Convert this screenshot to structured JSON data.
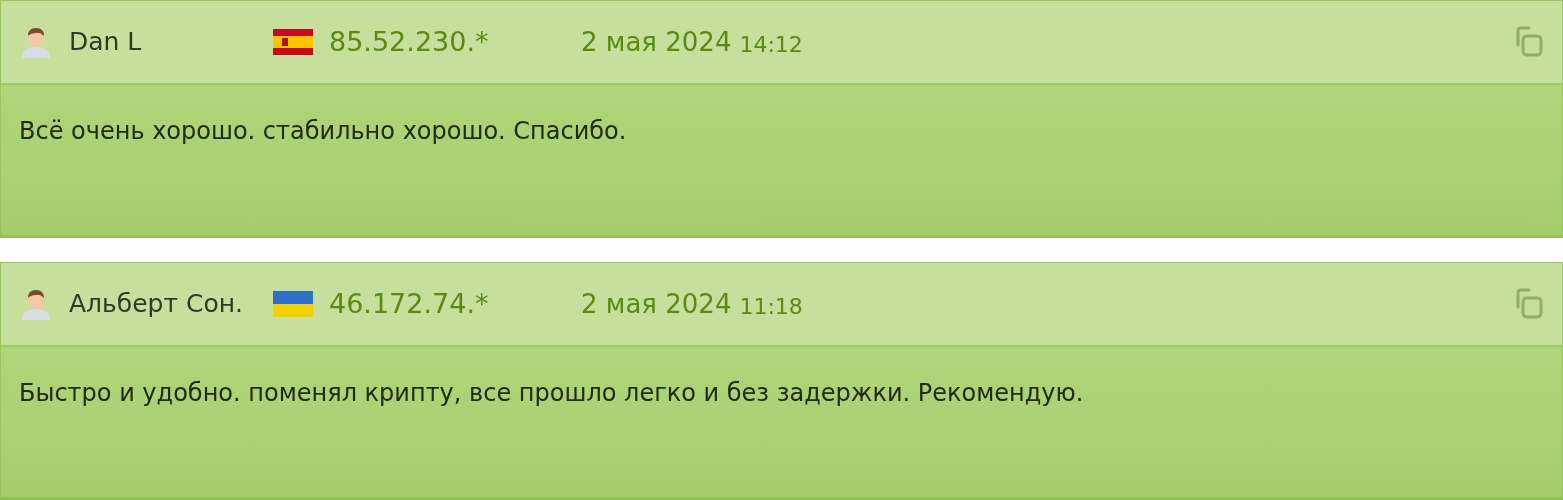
{
  "reviews": [
    {
      "author": "Dan L",
      "flag": {
        "kind": "spain"
      },
      "ip": "85.52.230.*",
      "date": "2 мая 2024",
      "time": "14:12",
      "text": "Всё очень хорошо. стабильно хорошо. Спасибо."
    },
    {
      "author": "Альберт Сон.",
      "flag": {
        "kind": "ukraine"
      },
      "ip": "46.172.74.*",
      "date": "2 мая 2024",
      "time": "11:18",
      "text": "Быстро и удобно. поменял крипту, все прошло легко и без задержки. Рекомендую."
    }
  ]
}
